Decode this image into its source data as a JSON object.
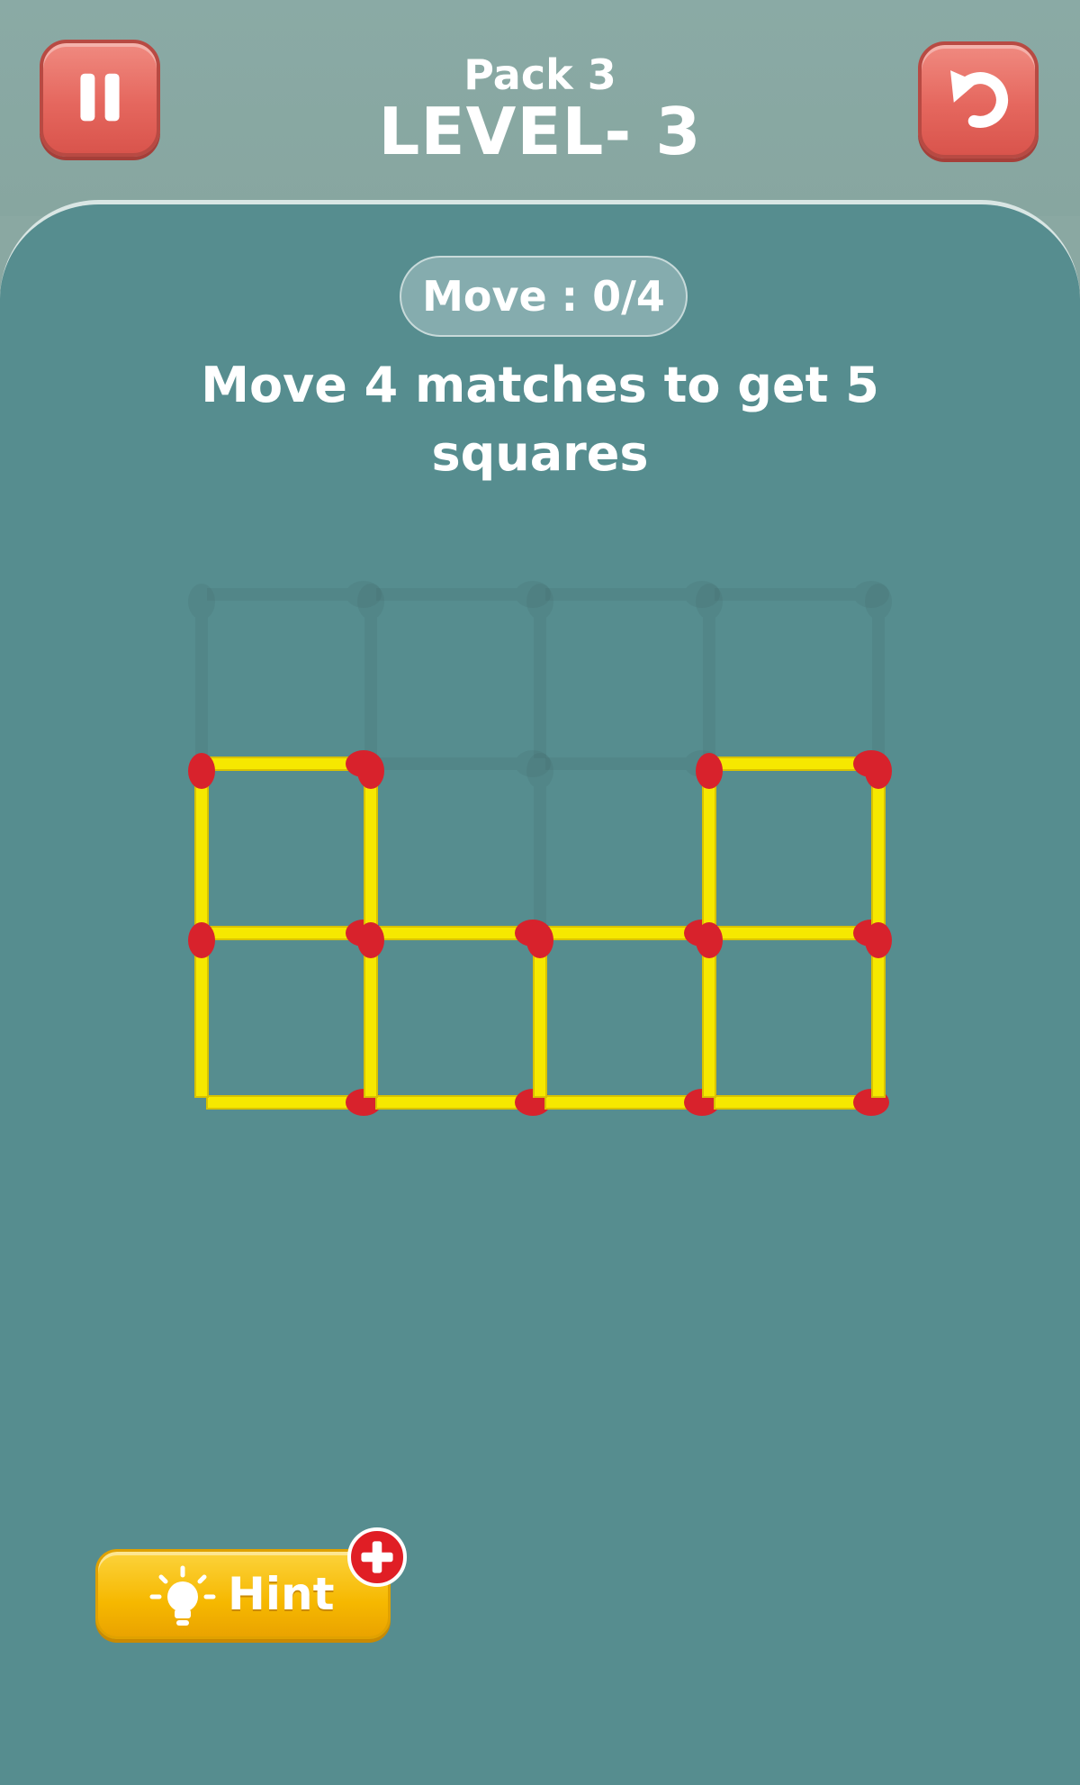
{
  "header": {
    "pack": "Pack 3",
    "level": "LEVEL- 3"
  },
  "status": {
    "move_counter": "Move : 0/4"
  },
  "instruction": "Move 4 matches to get 5 squares",
  "hint": {
    "label": "Hint"
  },
  "icons": {
    "pause": "pause-icon",
    "restart": "restart-icon",
    "bulb": "lightbulb-icon",
    "plus": "plus-icon"
  },
  "colors": {
    "match_stick": "#f6e800",
    "match_head": "#d8222c",
    "board": "#568d8f",
    "top_bar": "#8aa8a2",
    "button_red": "#e5675e",
    "hint_yellow": "#f6b800"
  },
  "board": {
    "grid_cols": 4,
    "grid_rows": 3,
    "slots_horizontal": [
      {
        "row": 0,
        "col": 0
      },
      {
        "row": 0,
        "col": 1
      },
      {
        "row": 0,
        "col": 2
      },
      {
        "row": 0,
        "col": 3
      },
      {
        "row": 1,
        "col": 1
      },
      {
        "row": 1,
        "col": 2
      }
    ],
    "slots_vertical": [
      {
        "row": 0,
        "col": 0
      },
      {
        "row": 0,
        "col": 1
      },
      {
        "row": 0,
        "col": 2
      },
      {
        "row": 0,
        "col": 3
      },
      {
        "row": 0,
        "col": 4
      },
      {
        "row": 1,
        "col": 2
      }
    ],
    "matches_horizontal": [
      {
        "row": 1,
        "col": 0
      },
      {
        "row": 1,
        "col": 3
      },
      {
        "row": 2,
        "col": 0
      },
      {
        "row": 2,
        "col": 1
      },
      {
        "row": 2,
        "col": 2
      },
      {
        "row": 2,
        "col": 3
      },
      {
        "row": 3,
        "col": 0
      },
      {
        "row": 3,
        "col": 1
      },
      {
        "row": 3,
        "col": 2
      },
      {
        "row": 3,
        "col": 3
      }
    ],
    "matches_vertical": [
      {
        "row": 1,
        "col": 0
      },
      {
        "row": 1,
        "col": 1
      },
      {
        "row": 1,
        "col": 3
      },
      {
        "row": 1,
        "col": 4
      },
      {
        "row": 2,
        "col": 0
      },
      {
        "row": 2,
        "col": 1
      },
      {
        "row": 2,
        "col": 2
      },
      {
        "row": 2,
        "col": 3
      },
      {
        "row": 2,
        "col": 4
      }
    ]
  }
}
